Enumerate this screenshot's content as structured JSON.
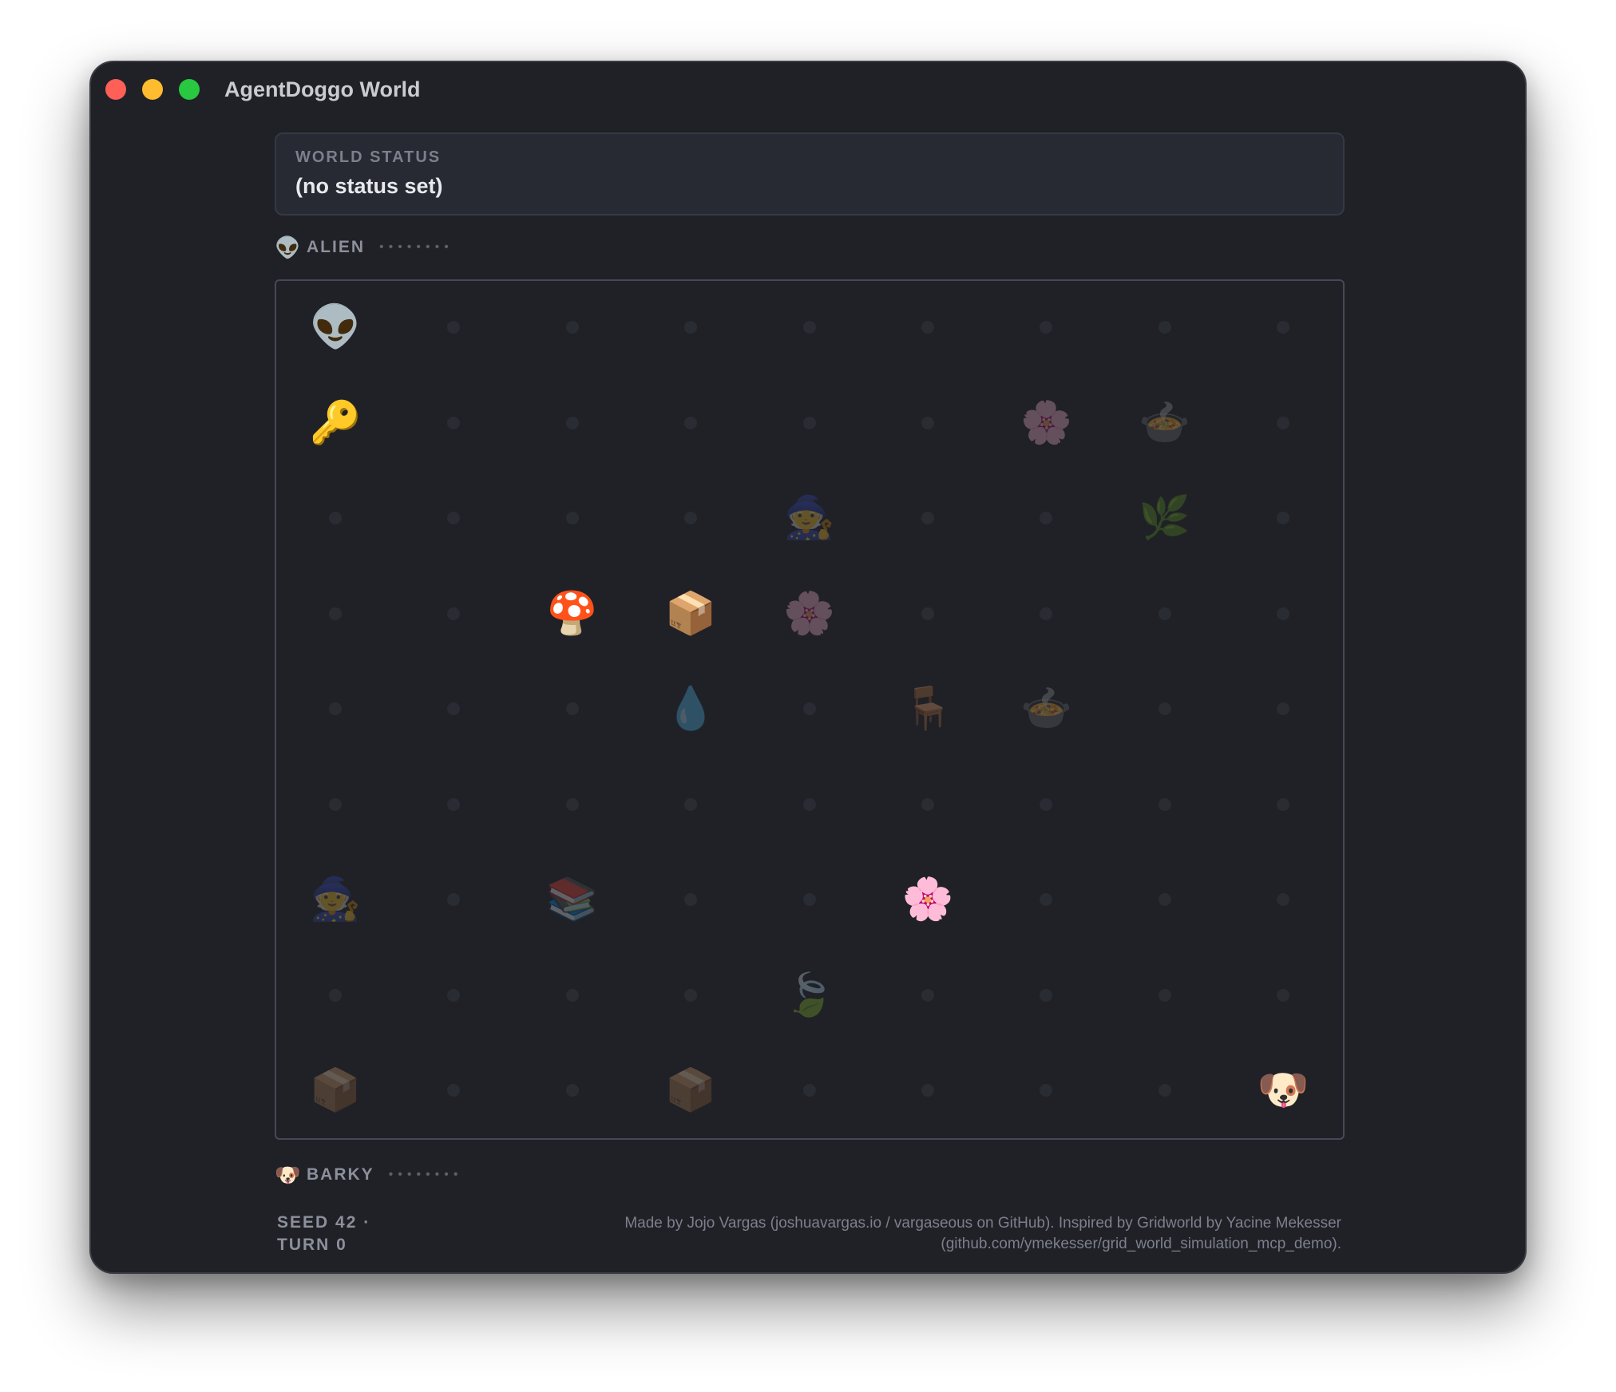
{
  "window": {
    "title": "AgentDoggo World"
  },
  "status": {
    "label": "WORLD STATUS",
    "text": "(no status set)"
  },
  "agents": {
    "top": {
      "icon": "👽",
      "name": "ALIEN",
      "dots": "••••••••"
    },
    "bottom": {
      "icon": "🐶",
      "name": "BARKY",
      "dots": "••••••••"
    }
  },
  "grid": {
    "cols": 9,
    "rows": 9,
    "items": [
      {
        "row": 0,
        "col": 0,
        "emoji": "👽",
        "name": "alien-agent-icon",
        "dim": false
      },
      {
        "row": 1,
        "col": 0,
        "emoji": "🔑",
        "name": "key-icon",
        "dim": false
      },
      {
        "row": 1,
        "col": 6,
        "emoji": "🌸",
        "name": "flower-icon",
        "dim": true
      },
      {
        "row": 1,
        "col": 7,
        "emoji": "🍲",
        "name": "pot-icon",
        "dim": true
      },
      {
        "row": 2,
        "col": 4,
        "emoji": "🧙",
        "name": "witch-icon",
        "dim": true
      },
      {
        "row": 2,
        "col": 7,
        "emoji": "🌿",
        "name": "herb-icon",
        "dim": true
      },
      {
        "row": 3,
        "col": 2,
        "emoji": "🍄",
        "name": "mushroom-icon",
        "dim": false
      },
      {
        "row": 3,
        "col": 3,
        "emoji": "📦",
        "name": "package-icon",
        "dim": false
      },
      {
        "row": 3,
        "col": 4,
        "emoji": "🌸",
        "name": "flower-icon",
        "dim": true
      },
      {
        "row": 4,
        "col": 3,
        "emoji": "💧",
        "name": "water-drop-icon",
        "dim": true
      },
      {
        "row": 4,
        "col": 5,
        "emoji": "🪑",
        "name": "chair-icon",
        "dim": true
      },
      {
        "row": 4,
        "col": 6,
        "emoji": "🍲",
        "name": "pot-icon",
        "dim": true
      },
      {
        "row": 6,
        "col": 0,
        "emoji": "🧙",
        "name": "witch-icon",
        "dim": true
      },
      {
        "row": 6,
        "col": 2,
        "emoji": "📚",
        "name": "books-icon",
        "dim": true
      },
      {
        "row": 6,
        "col": 5,
        "emoji": "🌸",
        "name": "flower-icon",
        "dim": false
      },
      {
        "row": 7,
        "col": 4,
        "emoji": "🍃",
        "name": "leaves-icon",
        "dim": true
      },
      {
        "row": 8,
        "col": 0,
        "emoji": "📦",
        "name": "package-icon",
        "dim": true
      },
      {
        "row": 8,
        "col": 3,
        "emoji": "📦",
        "name": "package-icon",
        "dim": true
      },
      {
        "row": 8,
        "col": 8,
        "emoji": "🐶",
        "name": "dog-agent-icon",
        "dim": false
      }
    ]
  },
  "footer": {
    "seed": "SEED 42 ·",
    "turn": "TURN 0",
    "credit_line1": "Made by Jojo Vargas (joshuavargas.io / vargaseous on GitHub). Inspired by Gridworld by Yacine Mekesser",
    "credit_line2": "(github.com/ymekesser/grid_world_simulation_mcp_demo)."
  }
}
